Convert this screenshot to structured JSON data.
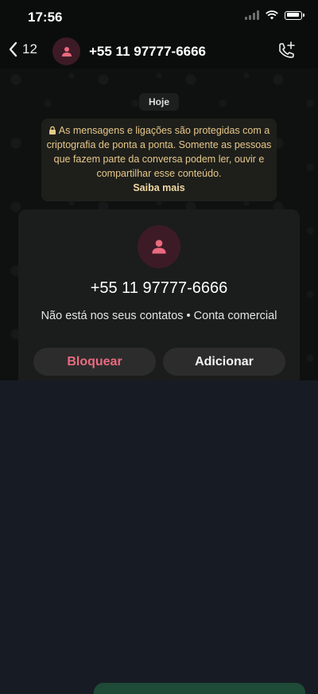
{
  "status_bar": {
    "time": "17:56"
  },
  "header": {
    "back_count": "12",
    "contact_name": "+55 11 97777-6666"
  },
  "chat": {
    "day_label": "Hoje",
    "encryption_notice": "As mensagens e ligações são protegidas com a criptografia de ponta a ponta. Somente as pessoas que fazem parte da conversa podem ler, ouvir e compartilhar esse conteúdo.",
    "learn_more": "Saiba mais"
  },
  "contact_card": {
    "phone": "+55 11 97777-6666",
    "info": "Não está nos seus contatos • Conta comercial",
    "block_label": "Bloquear",
    "add_label": "Adicionar"
  },
  "colors": {
    "accent_red": "#ea6a7f",
    "notice_text": "#e8c88a",
    "avatar_bg": "#3d1b26"
  }
}
